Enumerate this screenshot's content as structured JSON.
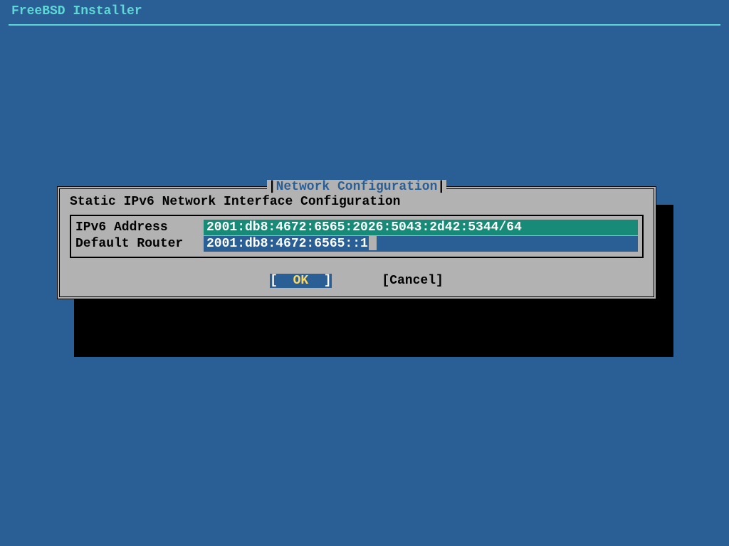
{
  "header": "FreeBSD Installer",
  "dialog": {
    "title": "Network Configuration",
    "subtitle": "Static IPv6 Network Interface Configuration",
    "fields": [
      {
        "label": "IPv6 Address",
        "value": "2001:db8:4672:6565:2026:5043:2d42:5344/64"
      },
      {
        "label": "Default Router",
        "value": "2001:db8:4672:6565::1"
      }
    ],
    "buttons": {
      "ok": "OK",
      "cancel": "Cancel"
    }
  }
}
